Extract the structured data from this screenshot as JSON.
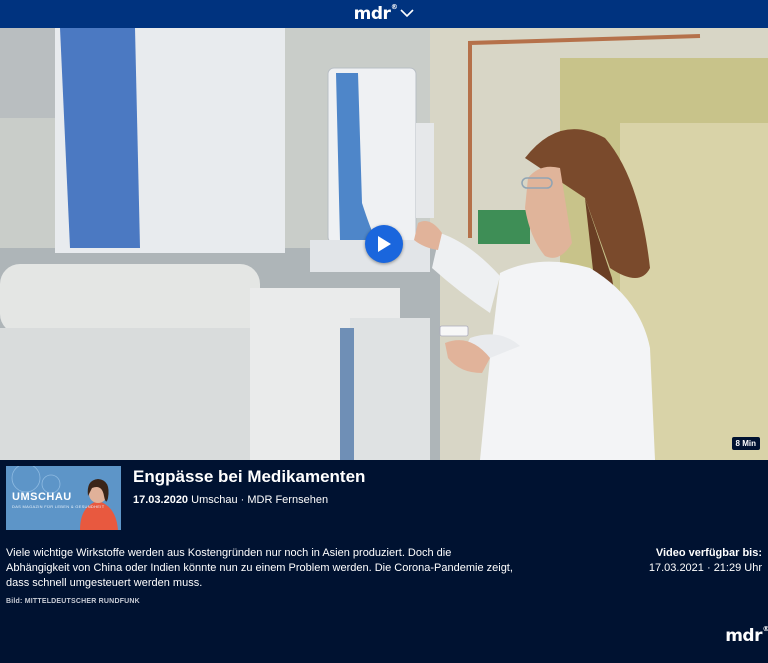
{
  "header": {
    "logo_text": "mdr",
    "logo_reg": "®",
    "menu_icon": "chevron-down-icon"
  },
  "video": {
    "duration": "8 Min",
    "play_icon": "play-icon"
  },
  "thumbnail": {
    "title": "UMSCHAU",
    "subtitle": "DAS MAGAZIN FÜR LEBEN & GESUNDHEIT"
  },
  "article": {
    "title": "Engpässe bei Medikamenten",
    "date": "17.03.2020",
    "meta": "Umschau · MDR Fernsehen",
    "description": "Viele wichtige Wirkstoffe werden aus Kostengründen nur noch in Asien produziert. Doch die Abhängigkeit von China oder Indien könnte nun zu einem Problem werden. Die Corona-Pandemie zeigt, dass schnell umgesteuert werden muss.",
    "credit": "Bild: MITTELDEUTSCHER RUNDFUNK"
  },
  "availability": {
    "label": "Video verfügbar bis:",
    "value": "17.03.2021 · 21:29 Uhr"
  },
  "footer": {
    "logo_text": "mdr",
    "logo_reg": "®"
  },
  "colors": {
    "header_bg": "#00337f",
    "page_bg": "#001231",
    "play_button": "#1a66dd"
  }
}
